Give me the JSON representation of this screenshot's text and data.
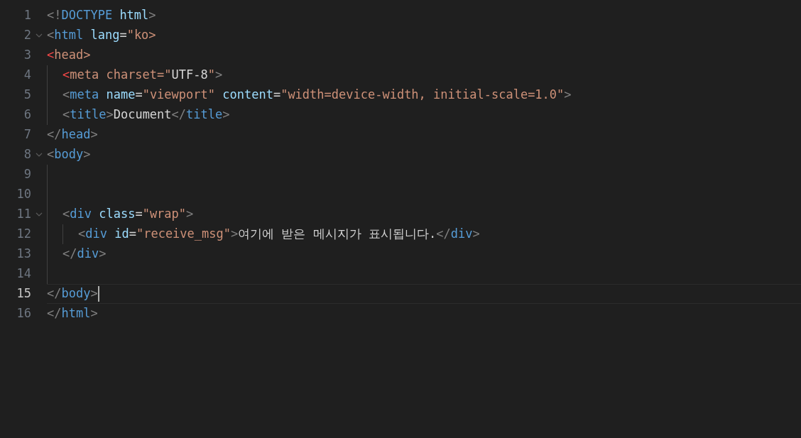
{
  "editor": {
    "lines": [
      {
        "number": "1",
        "fold": false,
        "current": false,
        "tokens": [
          {
            "kind": "bracket",
            "text": "<!"
          },
          {
            "kind": "tag",
            "text": "DOCTYPE"
          },
          {
            "kind": "attr",
            "text": " html"
          },
          {
            "kind": "bracket",
            "text": ">"
          }
        ]
      },
      {
        "number": "2",
        "fold": true,
        "current": false,
        "tokens": [
          {
            "kind": "bracket",
            "text": "<"
          },
          {
            "kind": "tag",
            "text": "html"
          },
          {
            "kind": "attr",
            "text": " lang"
          },
          {
            "kind": "plain",
            "text": "="
          },
          {
            "kind": "string",
            "text": "\"ko>"
          }
        ]
      },
      {
        "number": "3",
        "fold": false,
        "current": false,
        "tokens": [
          {
            "kind": "error",
            "text": "<"
          },
          {
            "kind": "string",
            "text": "head>"
          }
        ]
      },
      {
        "number": "4",
        "fold": false,
        "current": false,
        "tokens": [
          {
            "kind": "indent"
          },
          {
            "kind": "error",
            "text": "<"
          },
          {
            "kind": "string",
            "text": "meta charset=\""
          },
          {
            "kind": "plain",
            "text": "UTF-8"
          },
          {
            "kind": "string",
            "text": "\""
          },
          {
            "kind": "bracket",
            "text": ">"
          }
        ]
      },
      {
        "number": "5",
        "fold": false,
        "current": false,
        "tokens": [
          {
            "kind": "indent"
          },
          {
            "kind": "bracket",
            "text": "<"
          },
          {
            "kind": "tag",
            "text": "meta"
          },
          {
            "kind": "attr",
            "text": " name"
          },
          {
            "kind": "plain",
            "text": "="
          },
          {
            "kind": "string",
            "text": "\"viewport\""
          },
          {
            "kind": "attr",
            "text": " content"
          },
          {
            "kind": "plain",
            "text": "="
          },
          {
            "kind": "string",
            "text": "\"width=device-width, initial-scale=1.0\""
          },
          {
            "kind": "bracket",
            "text": ">"
          }
        ]
      },
      {
        "number": "6",
        "fold": false,
        "current": false,
        "tokens": [
          {
            "kind": "indent"
          },
          {
            "kind": "bracket",
            "text": "<"
          },
          {
            "kind": "tag",
            "text": "title"
          },
          {
            "kind": "bracket",
            "text": ">"
          },
          {
            "kind": "plain",
            "text": "Document"
          },
          {
            "kind": "bracket",
            "text": "</"
          },
          {
            "kind": "tag",
            "text": "title"
          },
          {
            "kind": "bracket",
            "text": ">"
          }
        ]
      },
      {
        "number": "7",
        "fold": false,
        "current": false,
        "tokens": [
          {
            "kind": "bracket",
            "text": "</"
          },
          {
            "kind": "tag",
            "text": "head"
          },
          {
            "kind": "bracket",
            "text": ">"
          }
        ]
      },
      {
        "number": "8",
        "fold": true,
        "current": false,
        "tokens": [
          {
            "kind": "bracket",
            "text": "<"
          },
          {
            "kind": "tag",
            "text": "body"
          },
          {
            "kind": "bracket",
            "text": ">"
          }
        ]
      },
      {
        "number": "9",
        "fold": false,
        "current": false,
        "tokens": [
          {
            "kind": "indent"
          }
        ]
      },
      {
        "number": "10",
        "fold": false,
        "current": false,
        "tokens": [
          {
            "kind": "indent"
          }
        ]
      },
      {
        "number": "11",
        "fold": true,
        "current": false,
        "tokens": [
          {
            "kind": "indent"
          },
          {
            "kind": "bracket",
            "text": "<"
          },
          {
            "kind": "tag",
            "text": "div"
          },
          {
            "kind": "attr",
            "text": " class"
          },
          {
            "kind": "plain",
            "text": "="
          },
          {
            "kind": "string",
            "text": "\"wrap\""
          },
          {
            "kind": "bracket",
            "text": ">"
          }
        ]
      },
      {
        "number": "12",
        "fold": false,
        "current": false,
        "tokens": [
          {
            "kind": "indent"
          },
          {
            "kind": "indent"
          },
          {
            "kind": "bracket",
            "text": "<"
          },
          {
            "kind": "tag",
            "text": "div"
          },
          {
            "kind": "attr",
            "text": " id"
          },
          {
            "kind": "plain",
            "text": "="
          },
          {
            "kind": "string",
            "text": "\"receive_msg\""
          },
          {
            "kind": "bracket",
            "text": ">"
          },
          {
            "kind": "plain",
            "text": "여기에 받은 메시지가 표시됩니다."
          },
          {
            "kind": "bracket",
            "text": "</"
          },
          {
            "kind": "tag",
            "text": "div"
          },
          {
            "kind": "bracket",
            "text": ">"
          }
        ]
      },
      {
        "number": "13",
        "fold": false,
        "current": false,
        "tokens": [
          {
            "kind": "indent"
          },
          {
            "kind": "bracket",
            "text": "</"
          },
          {
            "kind": "tag",
            "text": "div"
          },
          {
            "kind": "bracket",
            "text": ">"
          }
        ]
      },
      {
        "number": "14",
        "fold": false,
        "current": false,
        "tokens": [
          {
            "kind": "indent"
          }
        ]
      },
      {
        "number": "15",
        "fold": false,
        "current": true,
        "tokens": [
          {
            "kind": "bracket",
            "text": "</"
          },
          {
            "kind": "tag",
            "text": "body"
          },
          {
            "kind": "bracket",
            "text": ">"
          }
        ]
      },
      {
        "number": "16",
        "fold": false,
        "current": false,
        "tokens": [
          {
            "kind": "bracket",
            "text": "</"
          },
          {
            "kind": "tag",
            "text": "html"
          },
          {
            "kind": "bracket",
            "text": ">"
          }
        ]
      }
    ]
  }
}
